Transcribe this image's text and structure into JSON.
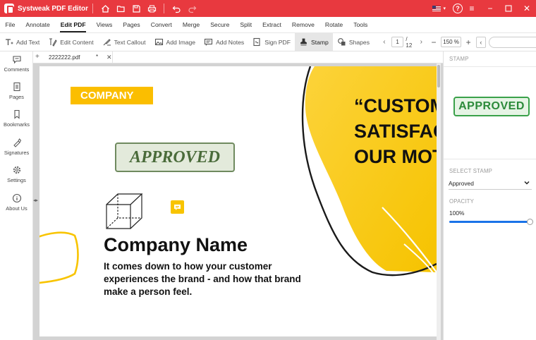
{
  "titlebar": {
    "title": "Systweak PDF Editor",
    "icons": [
      "home-icon",
      "folder-open-icon",
      "save-icon",
      "print-icon",
      "undo-icon",
      "redo-icon"
    ],
    "language_flag": "us-flag-icon",
    "accent_color": "#e8393f"
  },
  "menu": {
    "items": [
      "File",
      "Annotate",
      "Edit PDF",
      "Views",
      "Pages",
      "Convert",
      "Merge",
      "Secure",
      "Split",
      "Extract",
      "Remove",
      "Rotate",
      "Tools"
    ],
    "active": "Edit PDF"
  },
  "toolbar": {
    "tools": [
      {
        "label": "Add Text",
        "icon": "add-text-icon"
      },
      {
        "label": "Edit Content",
        "icon": "edit-content-icon"
      },
      {
        "label": "Text Callout",
        "icon": "text-callout-icon"
      },
      {
        "label": "Add Image",
        "icon": "add-image-icon"
      },
      {
        "label": "Add Notes",
        "icon": "add-notes-icon"
      },
      {
        "label": "Sign PDF",
        "icon": "sign-pdf-icon"
      },
      {
        "label": "Stamp",
        "icon": "stamp-icon"
      },
      {
        "label": "Shapes",
        "icon": "shapes-icon"
      }
    ],
    "active_tool": "Stamp",
    "current_page": "1",
    "total_pages": "/ 12",
    "zoom": "150 %",
    "search_placeholder": ""
  },
  "sidebar": {
    "items": [
      {
        "label": "Comments",
        "icon": "comments-icon"
      },
      {
        "label": "Pages",
        "icon": "pages-icon"
      },
      {
        "label": "Bookmarks",
        "icon": "bookmark-icon"
      },
      {
        "label": "Signatures",
        "icon": "signature-icon"
      },
      {
        "label": "Settings",
        "icon": "gear-icon"
      },
      {
        "label": "About Us",
        "icon": "info-icon"
      }
    ]
  },
  "document": {
    "tab_name": "2222222.pdf",
    "tab_modified": "*",
    "company_tag": "COMPANY",
    "stamp_text": "APPROVED",
    "company_name": "Company Name",
    "tagline": "It comes down to how your customer experiences the brand - and how that brand make a person feel.",
    "quote_lines": [
      "“CUSTOM",
      "SATISFAC",
      "OUR MOT"
    ],
    "brand_yellow": "#fbbe00"
  },
  "stamp_panel": {
    "heading": "STAMP",
    "preview_text": "APPROVED",
    "select_label": "SELECT STAMP",
    "selected_stamp": "Approved",
    "opacity_label": "OPACITY",
    "opacity_value": "100%",
    "opacity_level": 1.0,
    "stamp_color": "#3aa14a"
  }
}
